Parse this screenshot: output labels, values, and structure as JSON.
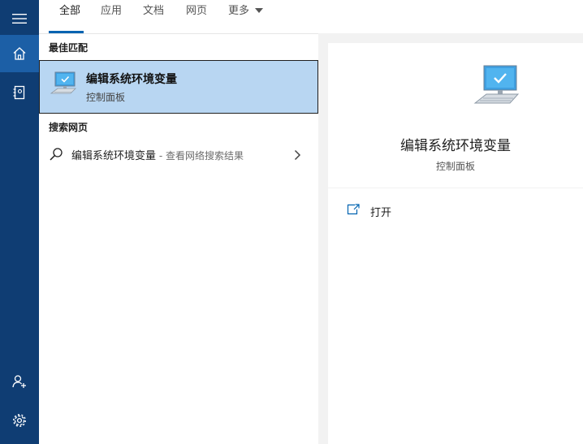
{
  "sidebar": {
    "items": [
      {
        "icon": "hamburger-menu-icon"
      },
      {
        "icon": "home-icon",
        "active": true
      },
      {
        "icon": "notebook-icon"
      },
      {
        "icon": "user-add-icon"
      },
      {
        "icon": "gear-icon"
      }
    ],
    "background": "#0f3d73",
    "active_background": "#1c5fa6"
  },
  "tabs": {
    "all": "全部",
    "apps": "应用",
    "documents": "文档",
    "web": "网页",
    "more": "更多"
  },
  "best_match": {
    "section_label": "最佳匹配",
    "title": "编辑系统环境变量",
    "subtitle": "控制面板",
    "icon": "computer-monitor-icon",
    "highlight_color": "#b8d6f2"
  },
  "web_search": {
    "section_label": "搜索网页",
    "query": "编辑系统环境变量",
    "hint": " - 查看网络搜索结果",
    "icon": "search-icon"
  },
  "detail": {
    "title": "编辑系统环境变量",
    "subtitle": "控制面板",
    "icon": "computer-monitor-icon"
  },
  "actions": {
    "open_label": "打开",
    "open_icon": "open-external-icon"
  },
  "colors": {
    "accent": "#0063b1",
    "pane_gray": "#f2f2f2"
  }
}
